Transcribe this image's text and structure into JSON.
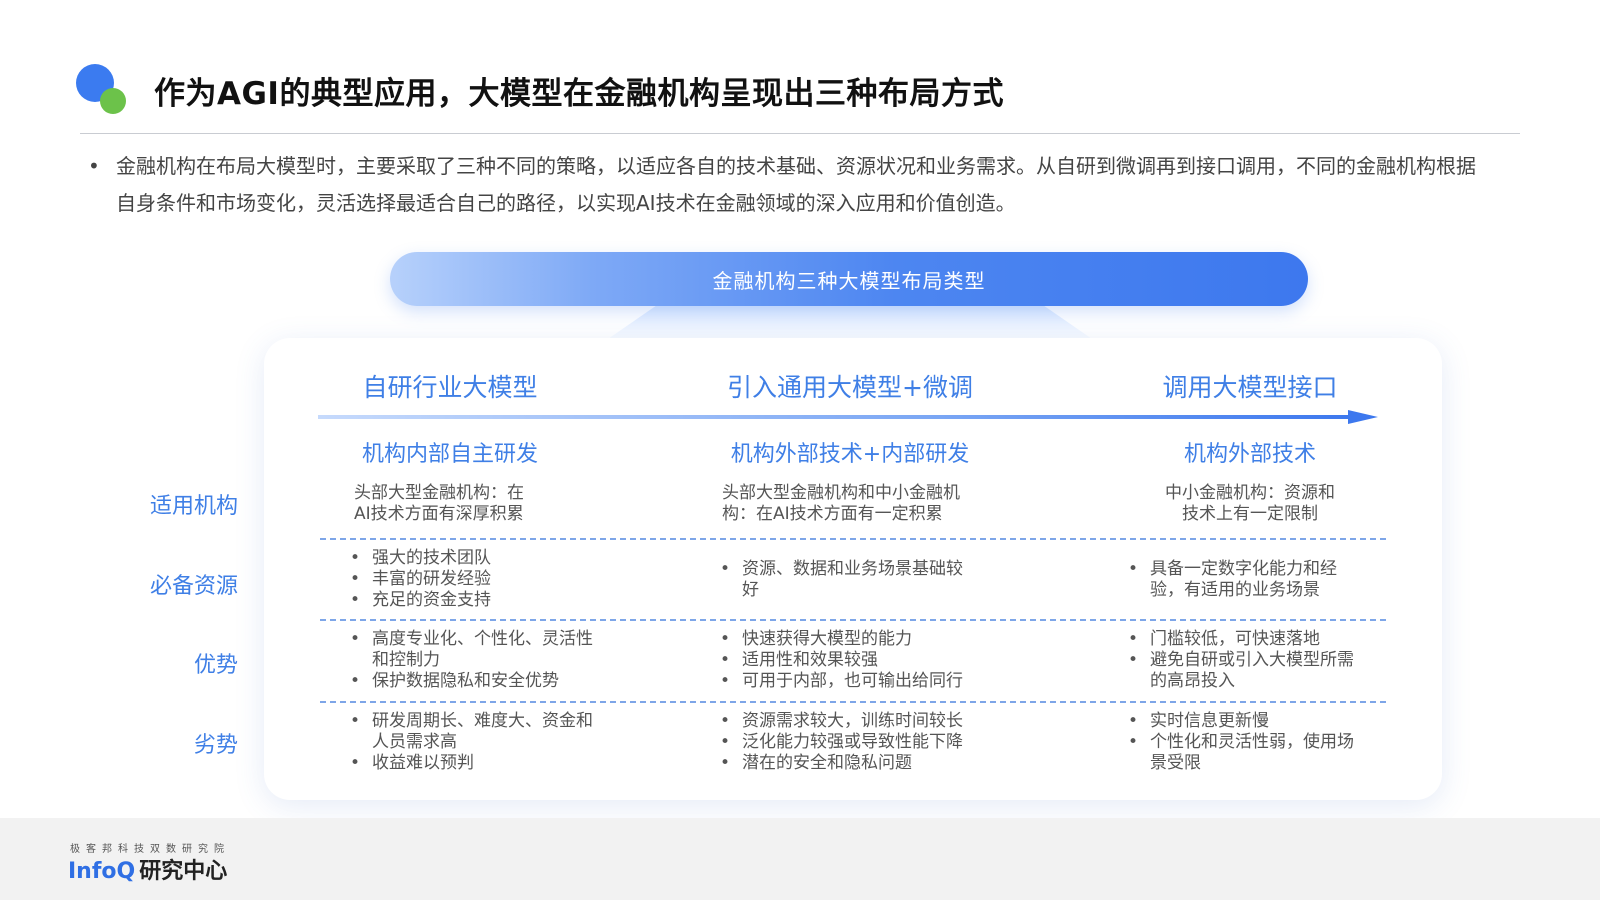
{
  "header": {
    "title": "作为AGI的典型应用，大模型在金融机构呈现出三种布局方式"
  },
  "intro": {
    "bullet": "•",
    "text": "金融机构在布局大模型时，主要采取了三种不同的策略，以适应各自的技术基础、资源状况和业务需求。从自研到微调再到接口调用，不同的金融机构根据自身条件和市场变化，灵活选择最适合自己的路径，以实现AI技术在金融领域的深入应用和价值创造。"
  },
  "diagram": {
    "banner": "金融机构三种大模型布局类型",
    "columns": [
      {
        "title": "自研行业大模型",
        "subtitle": "机构内部自主研发",
        "applicable": [
          "头部大型金融机构：在",
          "AI技术方面有深厚积累"
        ],
        "resources": [
          "强大的技术团队",
          "丰富的研发经验",
          "充足的资金支持"
        ],
        "advantages": [
          "高度专业化、个性化、灵活性和控制力",
          "保护数据隐私和安全优势"
        ],
        "disadvantages": [
          "研发周期长、难度大、资金和人员需求高",
          "收益难以预判"
        ]
      },
      {
        "title": "引入通用大模型+微调",
        "subtitle": "机构外部技术+内部研发",
        "applicable": [
          "头部大型金融机构和中小金融机",
          "构：在AI技术方面有一定积累"
        ],
        "resources": [
          "资源、数据和业务场景基础较好"
        ],
        "advantages": [
          "快速获得大模型的能力",
          "适用性和效果较强",
          "可用于内部，也可输出给同行"
        ],
        "disadvantages": [
          "资源需求较大，训练时间较长",
          "泛化能力较强或导致性能下降",
          "潜在的安全和隐私问题"
        ]
      },
      {
        "title": "调用大模型接口",
        "subtitle": "机构外部技术",
        "applicable": [
          "中小金融机构：资源和",
          "技术上有一定限制"
        ],
        "resources": [
          "具备一定数字化能力和经验，有适用的业务场景"
        ],
        "advantages": [
          "门槛较低，可快速落地",
          "避免自研或引入大模型所需的高昂投入"
        ],
        "disadvantages": [
          "实时信息更新慢",
          "个性化和灵活性弱，使用场景受限"
        ]
      }
    ],
    "row_labels": {
      "applicable": "适用机构",
      "resources": "必备资源",
      "advantages": "优势",
      "disadvantages": "劣势"
    }
  },
  "footer": {
    "org_small": "极客邦科技双数研究院",
    "brand_en": "InfoQ",
    "brand_cn": "研究中心"
  },
  "colors": {
    "accent_blue": "#3f7fe6",
    "logo_blue": "#3b7bf0",
    "logo_green": "#6cc24a"
  }
}
